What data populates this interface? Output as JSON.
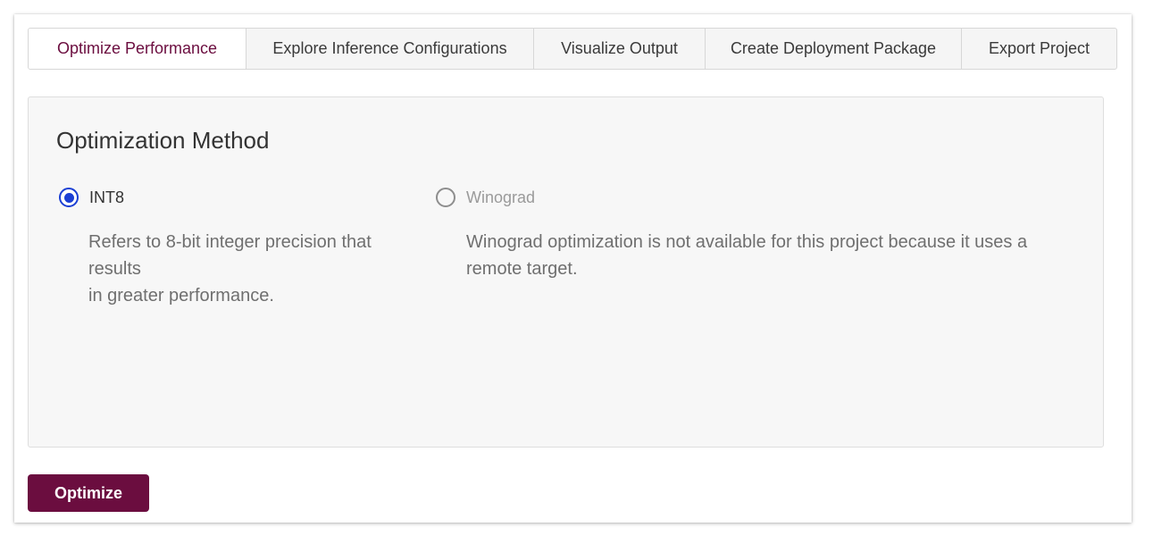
{
  "tabs": [
    {
      "label": "Optimize Performance",
      "active": true
    },
    {
      "label": "Explore Inference Configurations",
      "active": false
    },
    {
      "label": "Visualize Output",
      "active": false
    },
    {
      "label": "Create Deployment Package",
      "active": false
    },
    {
      "label": "Export Project",
      "active": false
    }
  ],
  "panel": {
    "title": "Optimization Method",
    "options": [
      {
        "label": "INT8",
        "selected": true,
        "disabled": false,
        "description_lines": [
          "Refers to 8-bit integer precision that results",
          "in greater performance."
        ]
      },
      {
        "label": "Winograd",
        "selected": false,
        "disabled": true,
        "description_lines": [
          "Winograd optimization is not available for this project because it uses a remote target."
        ]
      }
    ]
  },
  "actions": {
    "optimize_label": "Optimize"
  },
  "colors": {
    "accent": "#6b0d3f",
    "radio_selected": "#1b3fd4",
    "radio_disabled": "#8e8e8e"
  }
}
